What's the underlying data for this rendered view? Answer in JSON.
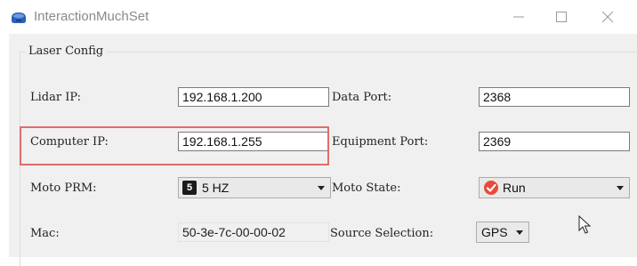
{
  "window": {
    "title": "InteractionMuchSet",
    "controls": {
      "minimize": "minimize-icon",
      "maximize": "maximize-icon",
      "close": "close-icon"
    }
  },
  "group": {
    "title": "Laser Config",
    "lidar_ip": {
      "label": "Lidar IP:",
      "value": "192.168.1.200"
    },
    "data_port": {
      "label": "Data Port:",
      "value": "2368"
    },
    "computer_ip": {
      "label": "Computer IP:",
      "value": "192.168.1.255"
    },
    "equipment_port": {
      "label": "Equipment Port:",
      "value": "2369"
    },
    "moto_prm": {
      "label": "Moto PRM:",
      "badge": "5",
      "value": "5 HZ"
    },
    "moto_state": {
      "label": "Moto State:",
      "value": "Run",
      "icon": "check-circle-icon"
    },
    "mac": {
      "label": "Mac:",
      "value": "50-3e-7c-00-00-02"
    },
    "source_selection": {
      "label": "Source Selection:",
      "value": "GPS"
    }
  },
  "colors": {
    "highlight": "#e06c6c",
    "run_icon": "#e84a3a",
    "window_bg": "#f0f0f0"
  }
}
